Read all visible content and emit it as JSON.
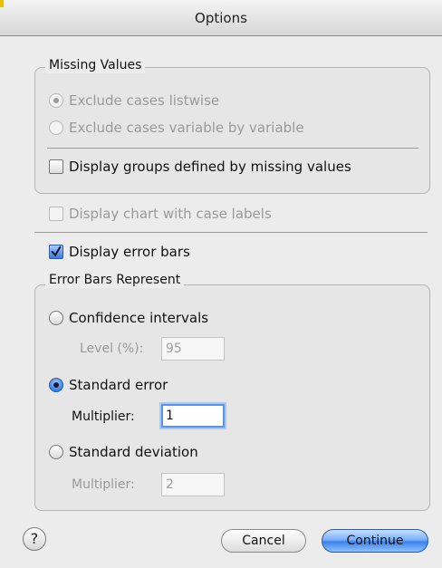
{
  "window": {
    "title": "Options"
  },
  "missing_values": {
    "legend": "Missing Values",
    "options": [
      {
        "label": "Exclude cases listwise",
        "selected": true,
        "enabled": false
      },
      {
        "label": "Exclude cases variable by variable",
        "selected": false,
        "enabled": false
      }
    ],
    "display_groups_label": "Display groups defined by missing values",
    "display_groups_checked": false
  },
  "case_labels": {
    "label": "Display chart with case labels",
    "checked": false,
    "enabled": false
  },
  "error_bars": {
    "label": "Display error bars",
    "checked": true
  },
  "error_bars_represent": {
    "legend": "Error Bars Represent",
    "confidence": {
      "label": "Confidence intervals",
      "selected": false,
      "level_label": "Level (%):",
      "level_value": "95"
    },
    "standard_error": {
      "label": "Standard error",
      "selected": true,
      "multiplier_label": "Multiplier:",
      "multiplier_value": "1"
    },
    "standard_deviation": {
      "label": "Standard deviation",
      "selected": false,
      "multiplier_label": "Multiplier:",
      "multiplier_value": "2"
    }
  },
  "buttons": {
    "help": "?",
    "cancel": "Cancel",
    "continue": "Continue"
  },
  "colors": {
    "accent": "#3d82ea",
    "background": "#ececec"
  }
}
